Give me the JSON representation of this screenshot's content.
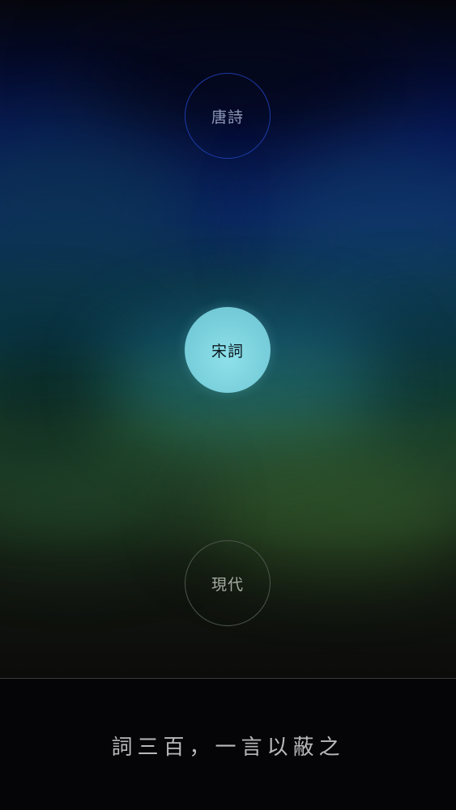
{
  "categories": [
    {
      "label": "唐詩",
      "selected": false
    },
    {
      "label": "宋詞",
      "selected": true
    },
    {
      "label": "現代",
      "selected": false
    }
  ],
  "footer": {
    "motto": "詞三百，一言以蔽之"
  },
  "colors": {
    "selected_circle": "#79cfdb",
    "tang_ring": "#1d3aa6",
    "modern_ring": "#4b554c",
    "footer_bg": "#050507",
    "motto_text": "#b9b9bc"
  }
}
